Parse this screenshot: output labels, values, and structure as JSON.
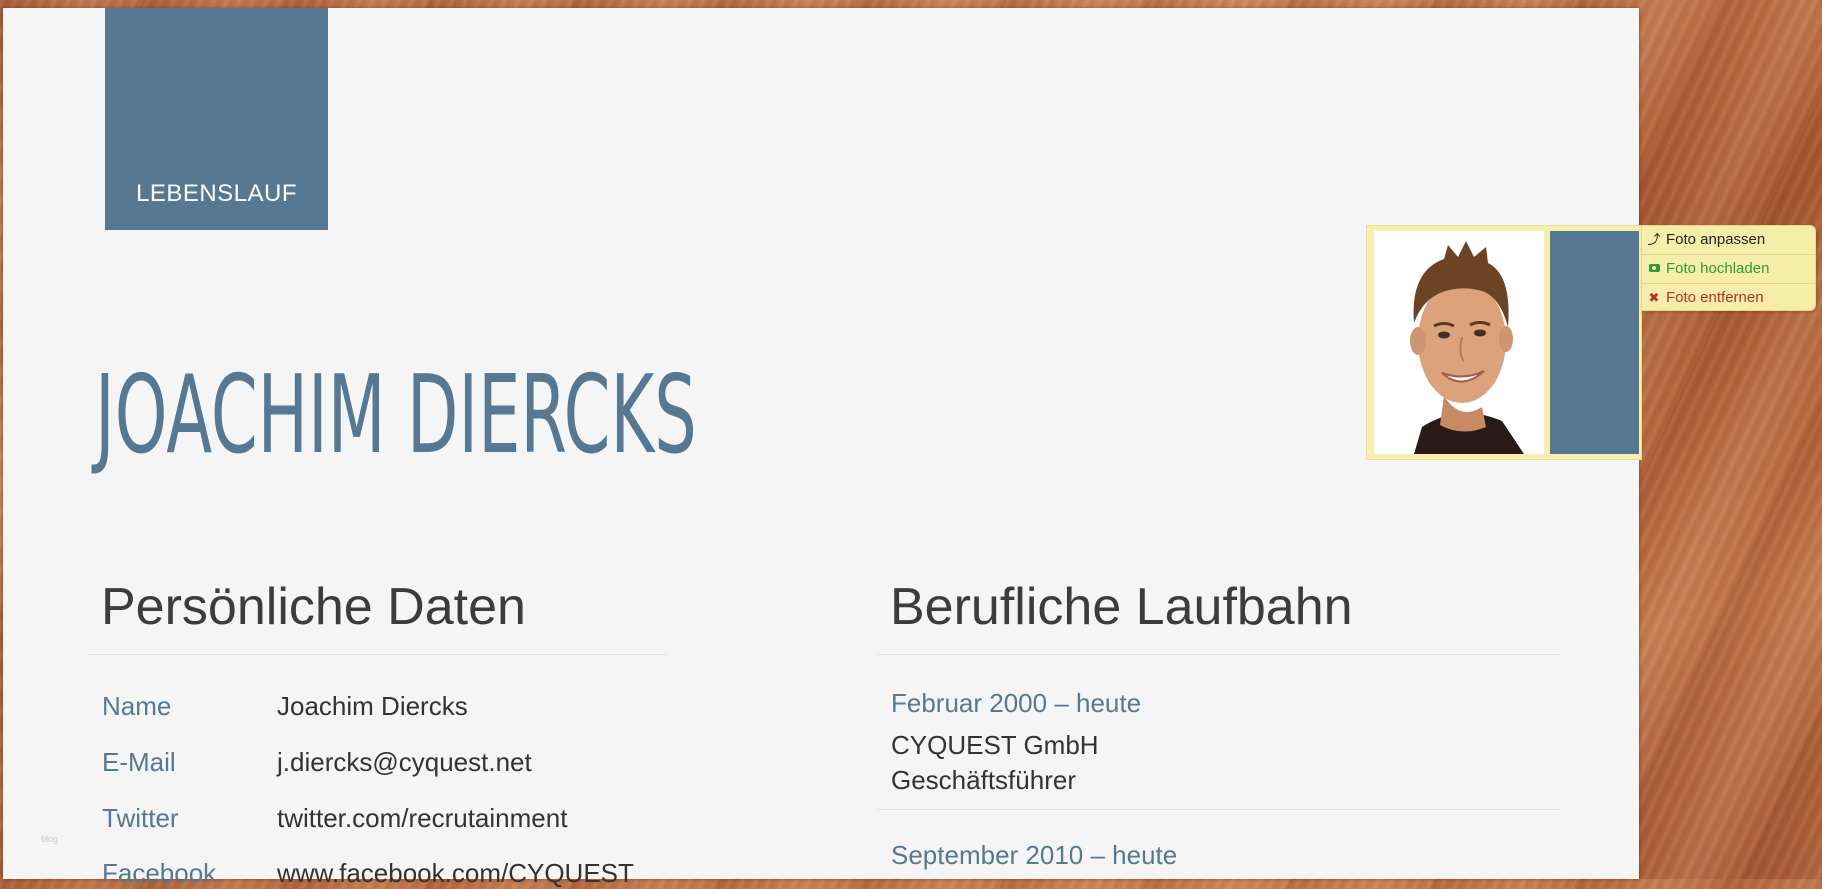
{
  "resume": {
    "badge": "LEBENSLAUF",
    "name": "JOACHIM DIERCKS"
  },
  "personal": {
    "heading": "Persönliche Daten",
    "rows": [
      {
        "label": "Name",
        "value": "Joachim Diercks"
      },
      {
        "label": "E-Mail",
        "value": "j.diercks@cyquest.net"
      },
      {
        "label": "Twitter",
        "value": "twitter.com/recrutainment"
      },
      {
        "label": "Facebook",
        "value": "www.facebook.com/CYQUEST"
      }
    ]
  },
  "career": {
    "heading": "Berufliche Laufbahn",
    "entries": [
      {
        "period": "Februar 2000 – heute",
        "company": "CYQUEST GmbH",
        "role": "Geschäftsführer"
      },
      {
        "period": "September 2010 – heute"
      }
    ]
  },
  "photo_menu": {
    "adjust": "Foto anpassen",
    "upload": "Foto hochladen",
    "remove": "Foto entfernen"
  },
  "watermark": "blog",
  "colors": {
    "accent": "#567892",
    "paper": "#f5f5f5",
    "widget": "#f6edaa",
    "upload": "#2e9a3a",
    "remove": "#b8321f"
  }
}
